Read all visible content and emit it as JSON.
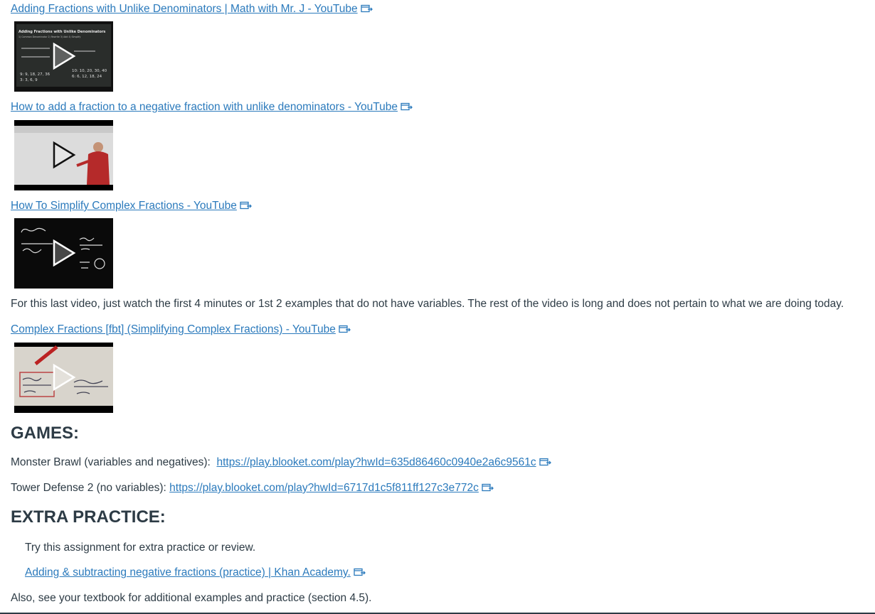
{
  "videos": [
    {
      "title": "Adding Fractions with Unlike Denominators | Math with Mr. J - YouTube"
    },
    {
      "title": "How to add a fraction to a negative fraction with unlike denominators - YouTube"
    },
    {
      "title": "How To Simplify Complex Fractions - YouTube"
    },
    {
      "title": "Complex Fractions [fbt] (Simplifying Complex Fractions) - YouTube"
    }
  ],
  "note": "For this last video, just watch the first 4 minutes or 1st 2 examples that do not have variables. The rest of the video is long and does not pertain to what we are doing today.",
  "games": {
    "heading": "GAMES:",
    "items": [
      {
        "label": "Monster Brawl (variables and negatives):",
        "url": "https://play.blooket.com/play?hwId=635d86460c0940e2a6c9561c"
      },
      {
        "label": "Tower Defense 2 (no variables):",
        "url": "https://play.blooket.com/play?hwId=6717d1c5f811ff127c3e772c"
      }
    ]
  },
  "extra": {
    "heading": "EXTRA PRACTICE:",
    "intro": "Try this assignment for extra practice or review.",
    "link": "Adding & subtracting negative fractions (practice) | Khan Academy.",
    "footer": "Also, see your textbook for additional examples and practice (section 4.5)."
  },
  "thumb1": {
    "title": "Adding Fractions with Unlike Denominators",
    "steps": "1) Common Denominator  2) Rewrite  3) Add  4) Simplify",
    "lcd1": "9: 9, 18, 27, 36",
    "lcd2": "10: 10, 20, 30, 40",
    "lcd3": "3: 3, 6, 9",
    "lcd4": "6: 6, 12, 18, 24"
  },
  "colors": {
    "link": "#2b7abc",
    "text": "#2d3b45"
  }
}
